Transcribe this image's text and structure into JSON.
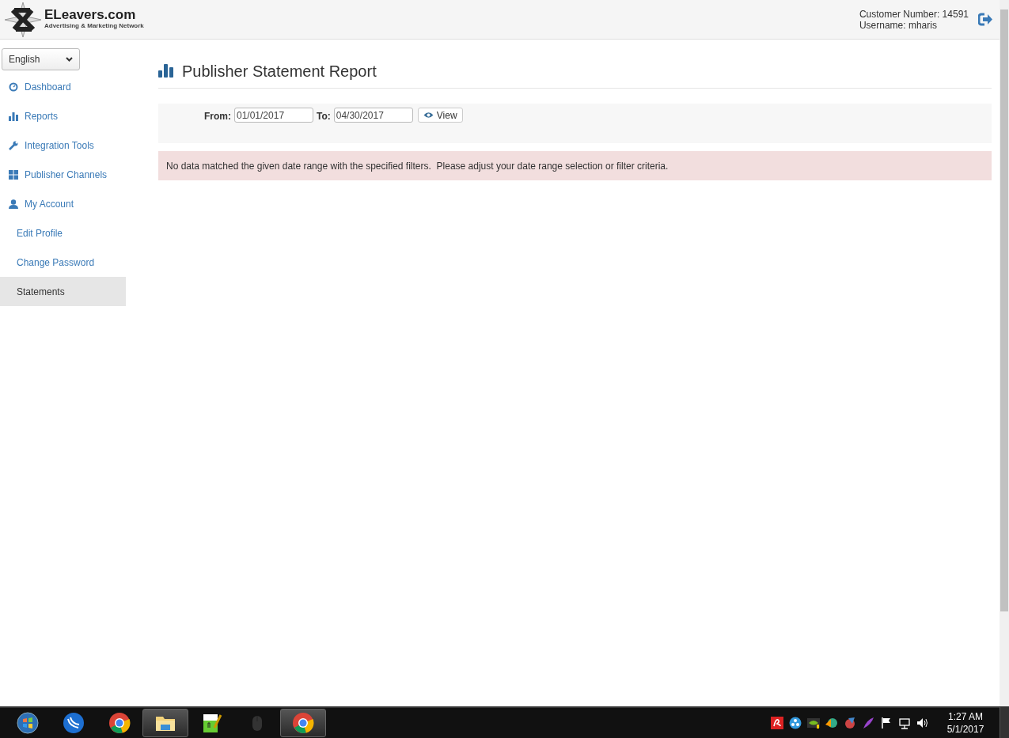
{
  "header": {
    "logo": {
      "name": "ELeavers.com",
      "tagline": "Advertising & Marketing Network"
    },
    "customer_number": "Customer Number: 14591",
    "username": "Username: mharis"
  },
  "language": {
    "value": "English"
  },
  "sidebar": {
    "items": [
      {
        "label": "Dashboard",
        "kind": "section",
        "selected": false
      },
      {
        "label": "Reports",
        "kind": "section",
        "selected": false
      },
      {
        "label": "Integration Tools",
        "kind": "section",
        "selected": false
      },
      {
        "label": "Publisher Channels",
        "kind": "section",
        "selected": false
      },
      {
        "label": "My Account",
        "kind": "section",
        "selected": false
      },
      {
        "label": "Edit Profile",
        "kind": "subitem",
        "selected": false
      },
      {
        "label": "Change Password",
        "kind": "subitem",
        "selected": false
      },
      {
        "label": "Statements",
        "kind": "subitem",
        "selected": true
      }
    ]
  },
  "page_title": "Publisher Statement Report",
  "filter": {
    "from_label": "From:",
    "from_value": "01/01/2017",
    "to_label": "To:",
    "to_value": "04/30/2017",
    "view_button": "View"
  },
  "alert": "No data matched the given date range with the specified filters.  Please adjust your date range selection or filter criteria.",
  "taskbar": {
    "apps": [
      {
        "kind": "start",
        "active": false
      },
      {
        "kind": "wave",
        "active": false
      },
      {
        "kind": "chrome",
        "active": false
      },
      {
        "kind": "folder",
        "active": true
      },
      {
        "kind": "notepad",
        "active": false
      },
      {
        "kind": "mouse",
        "active": false
      },
      {
        "kind": "chrome",
        "active": true
      }
    ],
    "tray": [
      {
        "kind": "antivirus"
      },
      {
        "kind": "dots"
      },
      {
        "kind": "gpu"
      },
      {
        "kind": "globe"
      },
      {
        "kind": "cleaner"
      },
      {
        "kind": "feather"
      },
      {
        "kind": "flag"
      },
      {
        "kind": "network"
      },
      {
        "kind": "volume"
      }
    ],
    "time": "1:27 AM",
    "date": "5/1/2017"
  }
}
